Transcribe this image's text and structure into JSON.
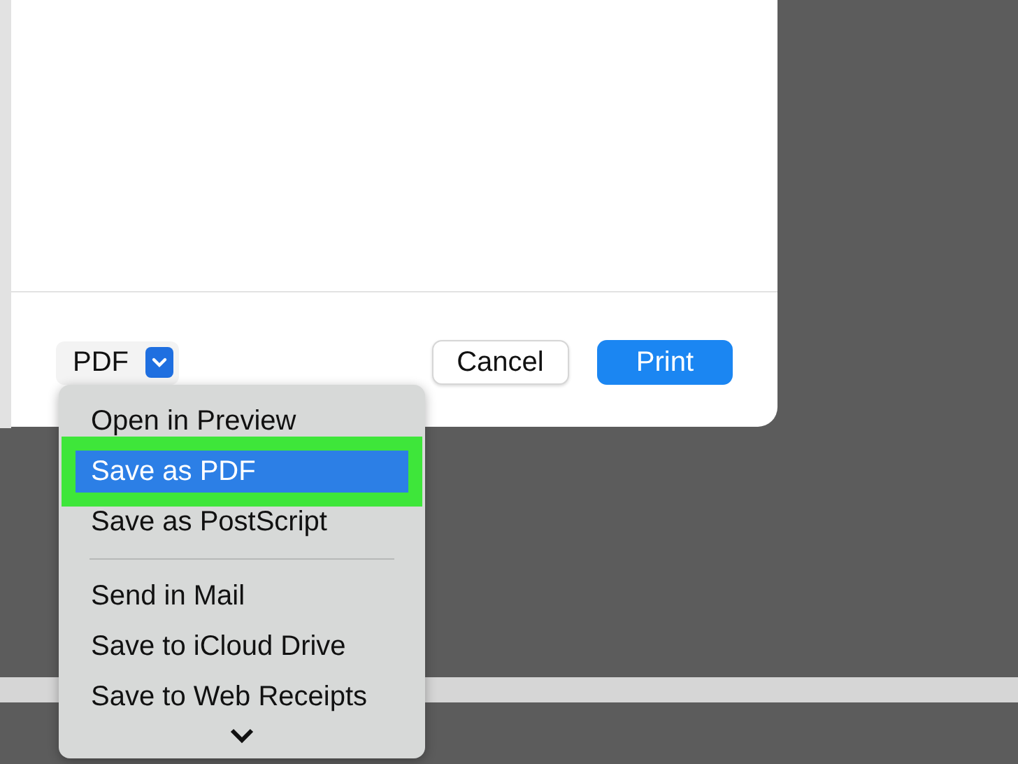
{
  "dialog": {
    "format_menu": {
      "label": "PDF"
    },
    "buttons": [
      {
        "label": "Cancel",
        "kind": "secondary"
      },
      {
        "label": "Print",
        "kind": "primary"
      }
    ]
  },
  "pdf_menu": {
    "items": [
      {
        "kind": "item",
        "label": "Open in Preview",
        "selected": false
      },
      {
        "kind": "item",
        "label": "Save as PDF",
        "selected": true
      },
      {
        "kind": "item",
        "label": "Save as PostScript",
        "selected": false
      },
      {
        "kind": "separator"
      },
      {
        "kind": "item",
        "label": "Send in Mail",
        "selected": false
      },
      {
        "kind": "item",
        "label": "Save to iCloud Drive",
        "selected": false
      },
      {
        "kind": "item",
        "label": "Save to Web Receipts",
        "selected": false
      }
    ]
  }
}
